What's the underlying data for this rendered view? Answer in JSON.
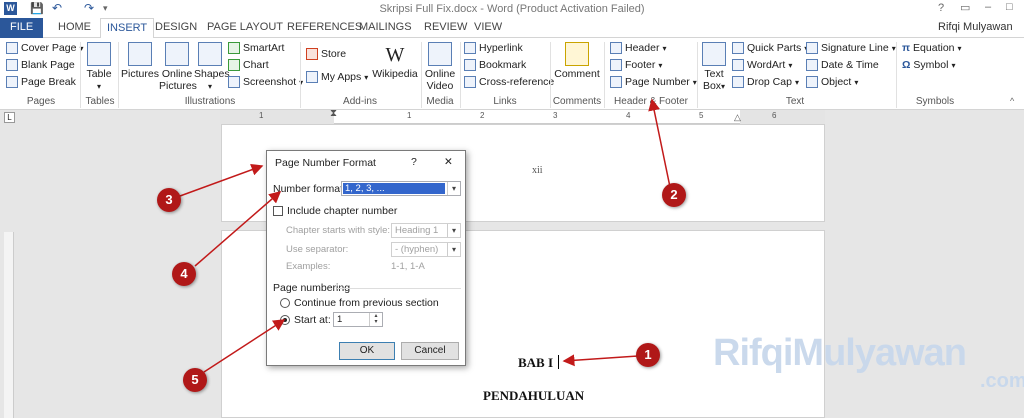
{
  "window": {
    "title": "Skripsi Full Fix.docx - Word (Product Activation Failed)",
    "user": "Rifqi Mulyawan",
    "help": "?"
  },
  "tabs": [
    "FILE",
    "HOME",
    "INSERT",
    "DESIGN",
    "PAGE LAYOUT",
    "REFERENCES",
    "MAILINGS",
    "REVIEW",
    "VIEW"
  ],
  "ribbon": {
    "pages": {
      "label": "Pages",
      "cover": "Cover Page",
      "blank": "Blank Page",
      "break": "Page Break"
    },
    "tables": {
      "label": "Tables",
      "table": "Table"
    },
    "illustrations": {
      "label": "Illustrations",
      "pictures": "Pictures",
      "online_pictures_1": "Online",
      "online_pictures_2": "Pictures",
      "shapes": "Shapes",
      "smartart": "SmartArt",
      "chart": "Chart",
      "screenshot": "Screenshot"
    },
    "addins": {
      "label": "Add-ins",
      "store": "Store",
      "myapps": "My Apps",
      "wikipedia": "Wikipedia"
    },
    "media": {
      "label": "Media",
      "video_1": "Online",
      "video_2": "Video"
    },
    "links": {
      "label": "Links",
      "hyperlink": "Hyperlink",
      "bookmark": "Bookmark",
      "crossref": "Cross-reference"
    },
    "comments": {
      "label": "Comments",
      "comment": "Comment"
    },
    "header_footer": {
      "label": "Header & Footer",
      "header": "Header",
      "footer": "Footer",
      "page_number": "Page Number"
    },
    "text": {
      "label": "Text",
      "textbox_1": "Text",
      "textbox_2": "Box",
      "quickparts": "Quick Parts",
      "wordart": "WordArt",
      "dropcap": "Drop Cap",
      "signature": "Signature Line",
      "datetime": "Date & Time",
      "object": "Object"
    },
    "symbols": {
      "label": "Symbols",
      "equation": "Equation",
      "symbol": "Symbol"
    }
  },
  "ruler": {
    "numbers": [
      "1",
      "1",
      "2",
      "3",
      "4",
      "5",
      "6"
    ]
  },
  "document": {
    "page_num": "xii",
    "chapter": "BAB I",
    "heading": "PENDAHULUAN"
  },
  "dialog": {
    "title": "Page Number Format",
    "help": "?",
    "close": "✕",
    "number_format_label": "Number format:",
    "number_format_value": "1, 2, 3, ...",
    "include_chapter": "Include chapter number",
    "chapter_style_label": "Chapter starts with style:",
    "chapter_style_value": "Heading 1",
    "separator_label": "Use separator:",
    "separator_value": "-  (hyphen)",
    "examples_label": "Examples:",
    "examples_value": "1-1, 1-A",
    "page_numbering": "Page numbering",
    "continue": "Continue from previous section",
    "start_at": "Start at:",
    "start_value": "1",
    "ok": "OK",
    "cancel": "Cancel"
  },
  "markers": [
    "1",
    "2",
    "3",
    "4",
    "5"
  ],
  "watermark": {
    "main": "RifqiMulyawan",
    "sub": ".com"
  },
  "colors": {
    "accent": "#2b579a",
    "marker": "#b01818",
    "selection": "#3366cc"
  }
}
